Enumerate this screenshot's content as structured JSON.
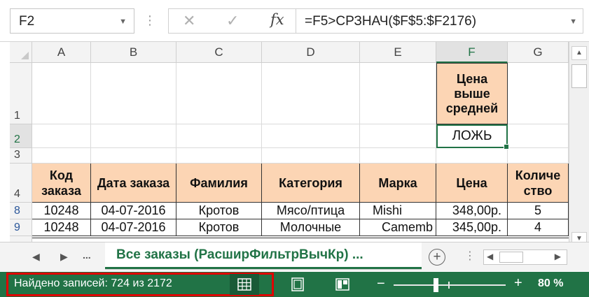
{
  "formula_bar": {
    "name_box": "F2",
    "icons": {
      "cancel": "cross-icon",
      "enter": "checkmark-icon",
      "function": "fx"
    },
    "formula": "=F5>СРЗНАЧ($F$5:$F2176)"
  },
  "grid": {
    "columns": [
      "A",
      "B",
      "C",
      "D",
      "E",
      "F",
      "G"
    ],
    "selected_column": "F",
    "rows": [
      "1",
      "2",
      "3",
      "4",
      "8",
      "9"
    ],
    "criteria_header": [
      "Цена",
      "выше",
      "средней"
    ],
    "criteria_value": "ЛОЖЬ",
    "table_headers": [
      [
        "Код",
        "заказа"
      ],
      [
        "Дата заказа"
      ],
      [
        "Фамилия"
      ],
      [
        "Категория"
      ],
      [
        "Марка"
      ],
      [
        "Цена"
      ],
      [
        "Количе",
        "ство"
      ]
    ],
    "table_rows": [
      [
        "10248",
        "04-07-2016",
        "Кротов",
        "Мясо/птица",
        "Mishi",
        "348,00р.",
        "5"
      ],
      [
        "10248",
        "04-07-2016",
        "Кротов",
        "Молочные",
        "Camemb",
        "345,00р.",
        "4"
      ]
    ]
  },
  "sheet_tabs": {
    "ellipsis": "...",
    "active_tab": "Все заказы (РасширФильтрВычКр) ...",
    "add_icon": "plus-circle-icon"
  },
  "status_bar": {
    "message": "Найдено записей: 724 из 2172",
    "zoom_minus": "−",
    "zoom_plus": "+",
    "zoom": "80 %",
    "zoom_level": 0.8,
    "accent": "#217346",
    "highlight": "#e00000"
  }
}
